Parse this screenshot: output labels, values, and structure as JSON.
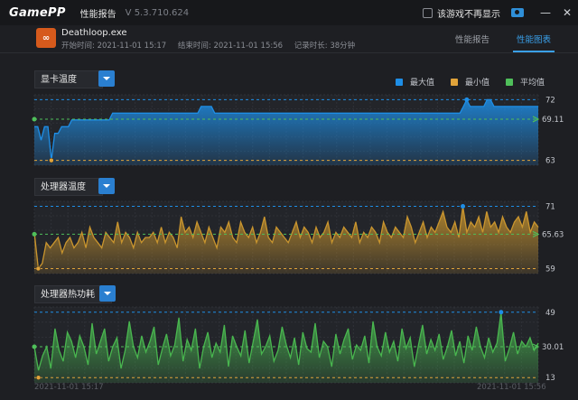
{
  "app": {
    "logo_a": "Game",
    "logo_b": "PP",
    "report_title": "性能报告",
    "version": "V 5.3.710.624",
    "dont_show_label": "该游戏不再显示",
    "minimize": "—",
    "close": "✕"
  },
  "session": {
    "icon_text": "∞",
    "exe": "Deathloop.exe",
    "start": "开始时间: 2021-11-01 15:17",
    "end": "结束时间: 2021-11-01 15:56",
    "duration": "记录时长: 38分钟"
  },
  "tabs": [
    {
      "label": "性能报告",
      "active": false
    },
    {
      "label": "性能图表",
      "active": true
    }
  ],
  "legend": [
    {
      "label": "最大值",
      "color": "#1e8ee6"
    },
    {
      "label": "最小值",
      "color": "#e0a33a"
    },
    {
      "label": "平均值",
      "color": "#4fbf5a"
    }
  ],
  "chart_data": [
    {
      "type": "area",
      "title": "显卡温度",
      "color": "#1e8ee6",
      "max_label": "72",
      "avg_label": "69.11",
      "min_label": "63",
      "max": 72,
      "avg": 69.11,
      "min": 63,
      "values": [
        68,
        68,
        66,
        68,
        68,
        63,
        67,
        67,
        68,
        68,
        68,
        69,
        69,
        69,
        69,
        69,
        69,
        69,
        69,
        69,
        69,
        69,
        69,
        70,
        70,
        70,
        70,
        70,
        70,
        70,
        70,
        70,
        70,
        70,
        70,
        70,
        70,
        70,
        70,
        70,
        70,
        70,
        70,
        70,
        70,
        70,
        70,
        70,
        70,
        71,
        71,
        71,
        71,
        70,
        70,
        70,
        70,
        70,
        70,
        70,
        70,
        70,
        70,
        70,
        70,
        70,
        70,
        70,
        70,
        70,
        70,
        70,
        70,
        70,
        70,
        70,
        70,
        70,
        70,
        70,
        70,
        70,
        70,
        70,
        70,
        70,
        70,
        70,
        70,
        70,
        70,
        70,
        70,
        70,
        70,
        70,
        70,
        70,
        70,
        70,
        70,
        70,
        70,
        70,
        70,
        70,
        70,
        70,
        70,
        70,
        70,
        70,
        70,
        70,
        70,
        70,
        70,
        70,
        70,
        70,
        70,
        70,
        70,
        70,
        70,
        70,
        71,
        72,
        71,
        71,
        71,
        71,
        71,
        72,
        72,
        71,
        71,
        71,
        71,
        71,
        71,
        71,
        71,
        71,
        71,
        71,
        71,
        71,
        71
      ]
    },
    {
      "type": "area",
      "title": "处理器温度",
      "color": "#c9952e",
      "max_label": "71",
      "avg_label": "65.63",
      "min_label": "59",
      "max": 71,
      "avg": 65.63,
      "min": 59,
      "values": [
        66,
        59,
        60,
        64,
        63,
        64,
        65,
        62,
        64,
        65,
        63,
        64,
        66,
        63,
        67,
        65,
        64,
        63,
        66,
        65,
        64,
        68,
        64,
        66,
        65,
        63,
        66,
        64,
        65,
        65,
        66,
        64,
        67,
        64,
        66,
        65,
        63,
        69,
        66,
        67,
        65,
        68,
        66,
        64,
        67,
        65,
        63,
        67,
        66,
        68,
        65,
        64,
        68,
        66,
        65,
        67,
        64,
        66,
        69,
        65,
        64,
        67,
        66,
        65,
        64,
        66,
        68,
        65,
        67,
        66,
        64,
        67,
        65,
        66,
        68,
        64,
        66,
        65,
        67,
        66,
        65,
        68,
        64,
        66,
        65,
        67,
        66,
        64,
        68,
        66,
        65,
        67,
        66,
        65,
        69,
        67,
        64,
        66,
        68,
        65,
        67,
        66,
        68,
        70,
        67,
        66,
        68,
        65,
        71,
        66,
        68,
        67,
        69,
        66,
        70,
        67,
        68,
        66,
        69,
        67,
        66,
        68,
        69,
        67,
        70,
        66,
        68,
        67
      ]
    },
    {
      "type": "area",
      "title": "处理器热功耗",
      "color": "#49b64f",
      "max_label": "49",
      "avg_label": "30.01",
      "min_label": "13",
      "max": 49,
      "avg": 30.01,
      "min": 13,
      "values": [
        30,
        17,
        25,
        30,
        18,
        40,
        28,
        22,
        38,
        33,
        24,
        36,
        30,
        20,
        43,
        26,
        33,
        40,
        22,
        30,
        35,
        18,
        28,
        44,
        30,
        24,
        36,
        27,
        33,
        41,
        20,
        29,
        37,
        25,
        31,
        46,
        22,
        34,
        28,
        40,
        18,
        30,
        38,
        24,
        32,
        27,
        42,
        19,
        36,
        30,
        25,
        39,
        21,
        33,
        45,
        26,
        30,
        36,
        22,
        28,
        41,
        31,
        24,
        35,
        20,
        38,
        29,
        27,
        43,
        24,
        33,
        30,
        19,
        37,
        26,
        34,
        40,
        23,
        31,
        28,
        36,
        21,
        44,
        30,
        25,
        38,
        27,
        33,
        22,
        40,
        29,
        35,
        19,
        31,
        42,
        26,
        34,
        28,
        37,
        23,
        30,
        39,
        25,
        33,
        21,
        36,
        28,
        41,
        30,
        24,
        35,
        27,
        32,
        49,
        22,
        29,
        38,
        26,
        33,
        30,
        35,
        28,
        32
      ]
    }
  ],
  "footer": {
    "start_time": "2021-11-01 15:17",
    "end_time": "2021-11-01 15:56"
  }
}
